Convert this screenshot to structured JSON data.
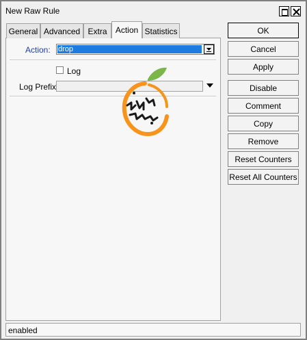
{
  "window": {
    "title": "New Raw Rule"
  },
  "tabs": [
    {
      "label": "General"
    },
    {
      "label": "Advanced"
    },
    {
      "label": "Extra"
    },
    {
      "label": "Action"
    },
    {
      "label": "Statistics"
    }
  ],
  "active_tab": "Action",
  "form": {
    "action_label": "Action:",
    "action_value": "drop",
    "log_label": "Log",
    "log_checked": false,
    "log_prefix_label": "Log Prefix:",
    "log_prefix_value": ""
  },
  "buttons": {
    "ok": "OK",
    "cancel": "Cancel",
    "apply": "Apply",
    "disable": "Disable",
    "comment": "Comment",
    "copy": "Copy",
    "remove": "Remove",
    "reset_counters": "Reset Counters",
    "reset_all_counters": "Reset All Counters"
  },
  "status": {
    "text": "enabled"
  },
  "colors": {
    "selection": "#1e7be0",
    "label_accent": "#1f3ea0",
    "logo_orange": "#f7941d",
    "logo_green": "#7ab648"
  },
  "icons": {
    "restore": "restore-icon",
    "close": "close-icon",
    "dropdown": "chevron-down-icon"
  }
}
